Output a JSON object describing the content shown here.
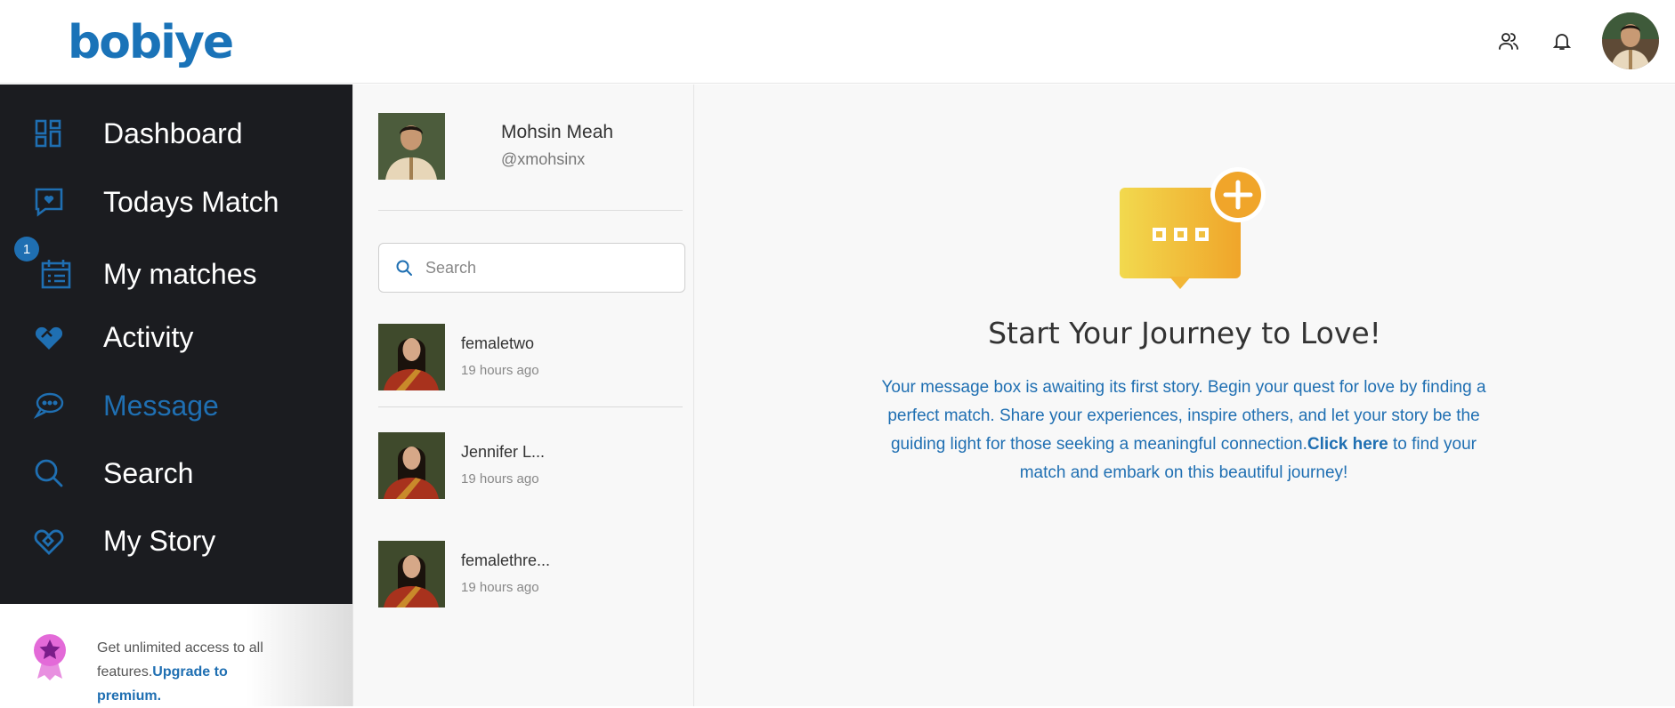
{
  "app": {
    "logo_text": "bobiye",
    "brand_color": "#1f6fb2",
    "sidebar_bg": "#1b1c20"
  },
  "header": {
    "icons": [
      "users-icon",
      "bell-icon"
    ],
    "avatar": "profile-avatar"
  },
  "sidebar": {
    "items": [
      {
        "label": "Dashboard",
        "icon": "dashboard-icon",
        "active": false
      },
      {
        "label": "Todays Match",
        "icon": "chat-heart-icon",
        "active": false
      },
      {
        "label": "My matches",
        "icon": "calendar-icon",
        "active": false,
        "badge": "1"
      },
      {
        "label": "Activity",
        "icon": "heart-handshake-icon",
        "active": false
      },
      {
        "label": "Message",
        "icon": "message-bubble-icon",
        "active": true
      },
      {
        "label": "Search",
        "icon": "search-icon",
        "active": false
      },
      {
        "label": "My Story",
        "icon": "heart-story-icon",
        "active": false
      }
    ]
  },
  "premium": {
    "text": "Get unlimited access to all features.",
    "link": "Upgrade to premium."
  },
  "chat": {
    "me": {
      "name": "Mohsin Meah",
      "handle": "@xmohsinx"
    },
    "search_placeholder": "Search",
    "conversations": [
      {
        "name": "femaletwo",
        "time": "19 hours ago"
      },
      {
        "name": "Jennifer L...",
        "time": "19 hours ago"
      },
      {
        "name": "femalethre...",
        "time": "19 hours ago"
      }
    ]
  },
  "main": {
    "title": "Start Your Journey to Love!",
    "text_before": "Your message box is awaiting its first story. Begin your quest for love by finding a perfect match. Share your experiences, inspire others, and let your story be the guiding light for those seeking a meaningful connection.",
    "link": "Click here",
    "text_after": " to find your match and embark on this beautiful journey!"
  }
}
